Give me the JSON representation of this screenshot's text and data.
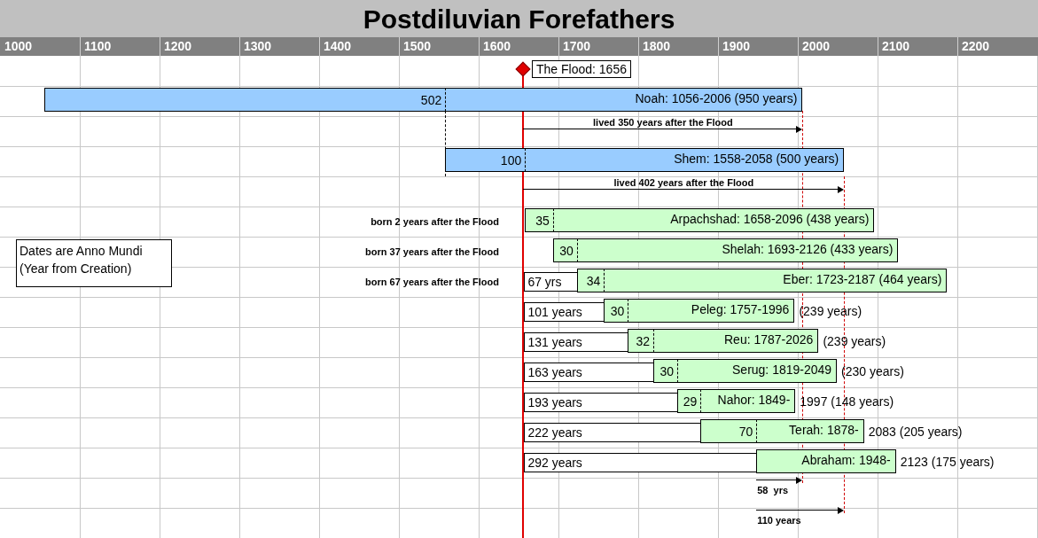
{
  "title": "Postdiluvian Forefathers",
  "axis_labels": [
    "1000",
    "1100",
    "1200",
    "1300",
    "1400",
    "1500",
    "1600",
    "1700",
    "1800",
    "1900",
    "2000",
    "2100",
    "2200"
  ],
  "flood": {
    "label": "The Flood: 1656"
  },
  "note": {
    "lines": [
      "Dates are Anno Mundi",
      "(Year from Creation)"
    ]
  },
  "rows": [
    {
      "kind": "person",
      "color": "#99ccff",
      "age": "502",
      "label": "Noah: 1056-2006 (950 years)"
    },
    {
      "kind": "span_above",
      "text": "lived 350  years after the Flood"
    },
    {
      "kind": "person",
      "color": "#99ccff",
      "age": "100",
      "label": "Shem: 1558-2058 (500 years)"
    },
    {
      "kind": "span_above",
      "text": "lived 402 years after the Flood"
    },
    {
      "kind": "person",
      "color": "#ccffcc",
      "age": "35",
      "label": "Arpachshad: 1658-2096 (438 years)",
      "pre_note": "born 2 years after the Flood"
    },
    {
      "kind": "person",
      "color": "#ccffcc",
      "age": "30",
      "label": "Shelah: 1693-2126 (433 years)",
      "pre_note": "born 37 years after the Flood"
    },
    {
      "kind": "person",
      "color": "#ccffcc",
      "age": "34",
      "label": "Eber: 1723-2187 (464 years)",
      "pre_note": "born 67 years after the Flood",
      "pre_box": "67 yrs"
    },
    {
      "kind": "person",
      "color": "#ccffcc",
      "age": "30",
      "label": "Peleg: 1757-1996",
      "after": "(239 years)",
      "pre_box": "101 years"
    },
    {
      "kind": "person",
      "color": "#ccffcc",
      "age": "32",
      "label": "Reu: 1787-2026",
      "after": "(239 years)",
      "pre_box": "131 years"
    },
    {
      "kind": "person",
      "color": "#ccffcc",
      "age": "30",
      "label": "Serug: 1819-2049",
      "after": "(230 years)",
      "pre_box": "163 years"
    },
    {
      "kind": "person",
      "color": "#ccffcc",
      "age": "29",
      "label": "Nahor: 1849-",
      "after": "1997 (148 years)",
      "pre_box": "193 years"
    },
    {
      "kind": "person",
      "color": "#ccffcc",
      "age": "70",
      "label": "Terah: 1878-",
      "after": "2083 (205 years)",
      "pre_box": "222 years"
    },
    {
      "kind": "person",
      "color": "#ccffcc",
      "label": "Abraham: 1948-",
      "after": "2123 (175 years)",
      "pre_box": "292 years"
    },
    {
      "kind": "span_below",
      "text": "58  yrs"
    },
    {
      "kind": "span_below",
      "text": "110 years"
    }
  ]
}
